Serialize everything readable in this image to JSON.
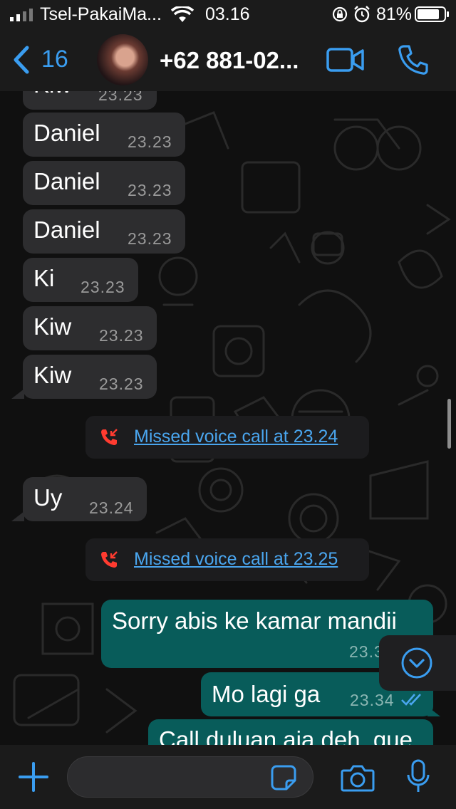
{
  "status_bar": {
    "carrier": "Tsel-PakaiMa...",
    "time": "03.16",
    "battery": "81%"
  },
  "header": {
    "back_count": "16",
    "contact_name": "+62 881-02...",
    "icons": [
      "chevron-left-icon",
      "video-call-icon",
      "phone-icon"
    ]
  },
  "messages": [
    {
      "text": "Kiw",
      "time": "23.23"
    },
    {
      "text": "Daniel",
      "time": "23.23"
    },
    {
      "text": "Daniel",
      "time": "23.23"
    },
    {
      "text": "Daniel",
      "time": "23.23"
    },
    {
      "text": "Ki",
      "time": "23.23"
    },
    {
      "text": "Kiw",
      "time": "23.23"
    },
    {
      "text": "Kiw",
      "time": "23.23"
    },
    {
      "text": "Missed voice call at 23.24"
    },
    {
      "text": "Uy",
      "time": "23.24"
    },
    {
      "text": "Missed voice call at 23.25"
    },
    {
      "text": "Sorry abis ke kamar mandii",
      "time": "23.3"
    },
    {
      "text": "Mo lagi ga",
      "time": "23.34"
    },
    {
      "text": "Call duluan aja deh, gue"
    }
  ],
  "input": {
    "placeholder": ""
  },
  "colors": {
    "accent": "#3a9df0",
    "incoming_bubble": "#2d2d2f",
    "outgoing_bubble": "#085c5a",
    "missed_call": "#ff3b30"
  }
}
